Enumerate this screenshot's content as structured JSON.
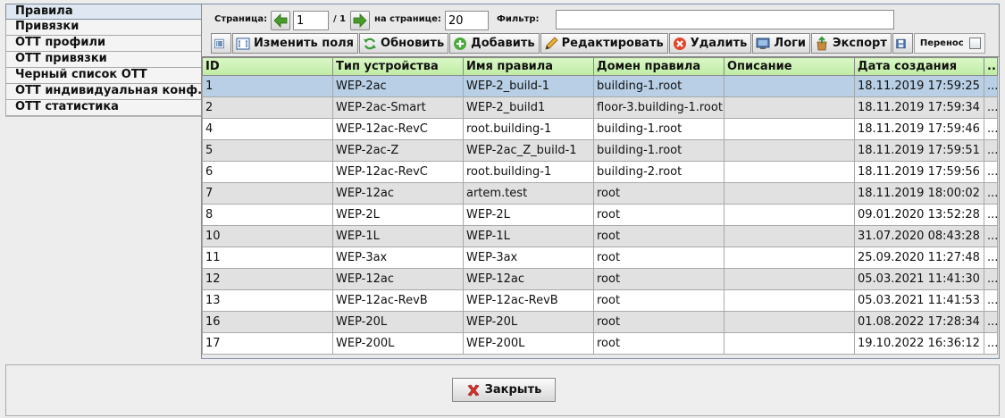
{
  "sidebar": {
    "items": [
      {
        "label": "Правила"
      },
      {
        "label": "Привязки"
      },
      {
        "label": "ОТТ профили"
      },
      {
        "label": "ОТТ привязки"
      },
      {
        "label": "Черный список ОТТ"
      },
      {
        "label": "ОТТ индивидуальная конф."
      },
      {
        "label": "ОТТ статистика"
      }
    ]
  },
  "pager": {
    "page_label": "Страница:",
    "page_value": "1",
    "page_total": "/ 1",
    "per_page_label": "на странице:",
    "per_page_value": "20",
    "filter_label": "Фильтр:",
    "filter_value": ""
  },
  "toolbar": {
    "change_fields": "Изменить поля",
    "refresh": "Обновить",
    "add": "Добавить",
    "edit": "Редактировать",
    "delete": "Удалить",
    "logs": "Логи",
    "export": "Экспорт",
    "wrap": "Перенос"
  },
  "table": {
    "columns": [
      "ID",
      "Тип устройства",
      "Имя правила",
      "Домен правила",
      "Описание",
      "Дата создания",
      ".."
    ],
    "rows": [
      [
        "1",
        "WEP-2ac",
        "WEP-2_build-1",
        "building-1.root",
        "",
        "18.11.2019 17:59:25",
        "..."
      ],
      [
        "2",
        "WEP-2ac-Smart",
        "WEP-2_build1",
        "floor-3.building-1.root",
        "",
        "18.11.2019 17:59:34",
        "..."
      ],
      [
        "4",
        "WEP-12ac-RevC",
        "root.building-1",
        "building-1.root",
        "",
        "18.11.2019 17:59:46",
        "..."
      ],
      [
        "5",
        "WEP-2ac-Z",
        "WEP-2ac_Z_build-1",
        "building-1.root",
        "",
        "18.11.2019 17:59:51",
        "..."
      ],
      [
        "6",
        "WEP-12ac-RevC",
        "root.building-1",
        "building-2.root",
        "",
        "18.11.2019 17:59:56",
        "..."
      ],
      [
        "7",
        "WEP-12ac",
        "artem.test",
        "root",
        "",
        "18.11.2019 18:00:02",
        "..."
      ],
      [
        "8",
        "WEP-2L",
        "WEP-2L",
        "root",
        "",
        "09.01.2020 13:52:28",
        "..."
      ],
      [
        "10",
        "WEP-1L",
        "WEP-1L",
        "root",
        "",
        "31.07.2020 08:43:28",
        "..."
      ],
      [
        "11",
        "WEP-3ax",
        "WEP-3ax",
        "root",
        "",
        "25.09.2020 11:27:48",
        "..."
      ],
      [
        "12",
        "WEP-12ac",
        "WEP-12ac",
        "root",
        "",
        "05.03.2021 11:41:30",
        "..."
      ],
      [
        "13",
        "WEP-12ac-RevB",
        "WEP-12ac-RevB",
        "root",
        "",
        "05.03.2021 11:41:53",
        "..."
      ],
      [
        "16",
        "WEP-20L",
        "WEP-20L",
        "root",
        "",
        "01.08.2022 17:28:34",
        "..."
      ],
      [
        "17",
        "WEP-200L",
        "WEP-200L",
        "root",
        "",
        "19.10.2022 16:36:12",
        "..."
      ]
    ]
  },
  "footer": {
    "close": "Закрыть"
  },
  "colors": {
    "header_green": "#c6efae",
    "selected_row": "#b8cfe5",
    "alt_row": "#e1e1e1"
  }
}
